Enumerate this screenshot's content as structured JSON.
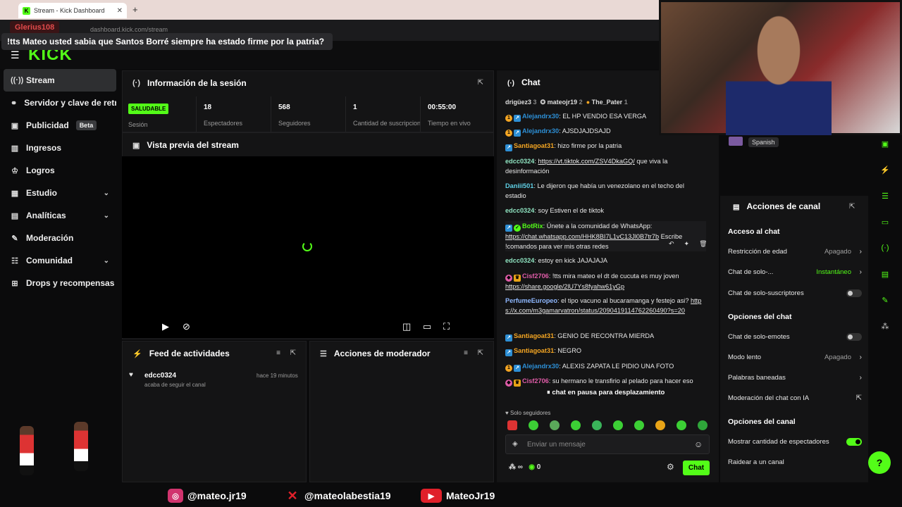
{
  "browser": {
    "tab_title": "Stream - Kick Dashboard",
    "tab_close": "✕",
    "new_tab": "+",
    "url": "dashboard.kick.com/stream"
  },
  "alert": {
    "user": "Glerius108",
    "message": "!tts Mateo usted sabia que Santos Borré siempre ha estado firme por la patria?"
  },
  "logo": "KICK",
  "sidebar": {
    "items": [
      {
        "label": "Stream",
        "icon": "broadcast-icon"
      },
      {
        "label": "Servidor y clave de retransmisión",
        "icon": "link-icon"
      },
      {
        "label": "Publicidad",
        "badge": "Beta",
        "icon": "ads-icon"
      },
      {
        "label": "Ingresos",
        "icon": "chart-icon"
      },
      {
        "label": "Logros",
        "icon": "trophy-icon"
      },
      {
        "label": "Estudio",
        "icon": "studio-icon"
      },
      {
        "label": "Analíticas",
        "icon": "analytics-icon"
      },
      {
        "label": "Moderación",
        "icon": "wrench-icon"
      },
      {
        "label": "Comunidad",
        "icon": "community-icon"
      },
      {
        "label": "Drops y recompensas",
        "icon": "gift-icon"
      }
    ]
  },
  "session": {
    "title": "Información de la sesión",
    "status": "SALUDABLE",
    "stats": [
      {
        "value": "",
        "label": "Sesión"
      },
      {
        "value": "18",
        "label": "Espectadores"
      },
      {
        "value": "568",
        "label": "Seguidores"
      },
      {
        "value": "1",
        "label": "Cantidad de suscripciones"
      },
      {
        "value": "00:55:00",
        "label": "Tiempo en vivo"
      }
    ]
  },
  "preview": {
    "title": "Vista previa del stream"
  },
  "feed": {
    "title": "Feed de actividades",
    "item_user": "edcc0324",
    "item_desc": "acaba de seguir el canal",
    "item_time": "hace 19 minutos"
  },
  "mod_actions": {
    "title": "Acciones de moderador"
  },
  "chat": {
    "title": "Chat",
    "top_users": [
      {
        "name": "drigüez3",
        "count": "3"
      },
      {
        "name": "mateojr19",
        "count": "2"
      },
      {
        "name": "The_Pater",
        "count": "1"
      }
    ],
    "messages": [
      {
        "user": "Alejandrx30",
        "color": "#2d8fd5",
        "text": "EL HP VENDIO ESA VERGA"
      },
      {
        "user": "Alejandrx30",
        "color": "#2d8fd5",
        "text": "AJSDJAJDSAJD"
      },
      {
        "user": "Santiagoat31",
        "color": "#f5a623",
        "text": "hizo firme por la patria"
      },
      {
        "user": "edcc0324",
        "color": "#8fe3c0",
        "link": "https://vt.tiktok.com/ZSV4DkaGQ/",
        "text": "que viva la desinformación"
      },
      {
        "user": "Daniii501",
        "color": "#5fd0e6",
        "text": "Le dijeron que había un venezolano en el techo del estadio"
      },
      {
        "user": "edcc0324",
        "color": "#8fe3c0",
        "text": "soy Estiven el de tiktok"
      },
      {
        "user": "BotRix",
        "color": "#53fc18",
        "text": "Únete a la comunidad de WhatsApp:",
        "link": "https://chat.whatsapp.com/HHK8BI7L1vC13Jl0B7tr7b",
        "text2": "Escribe !comandos para ver mis otras redes"
      },
      {
        "user": "edcc0324",
        "color": "#8fe3c0",
        "text": "estoy en kick JAJAJAJA"
      },
      {
        "user": "Cisf2706",
        "color": "#e05ca8",
        "text": "!tts mira mateo el dt de cucuta es muy joven",
        "link": "https://share.google/2lU7Ys8fyahw61yGp"
      },
      {
        "user": "PerfumeEuropeo",
        "color": "#8fb8ff",
        "text": "el tipo vacuno al bucaramanga y festejo asi?",
        "link": "https://x.com/m3gamarvatron/status/2090419114762260490?s=20"
      },
      {
        "user": "Santiagoat31",
        "color": "#f5a623",
        "text": "GENIO DE RECONTRA MIERDA"
      },
      {
        "user": "Santiagoat31",
        "color": "#f5a623",
        "text": "NEGRO"
      },
      {
        "user": "Alejandrx30",
        "color": "#2d8fd5",
        "text": "ALEXIS ZAPATA LE PIDIO UNA FOTO"
      },
      {
        "user": "Cisf2706",
        "color": "#e05ca8",
        "text": "su hermano le transfirio al pelado para hacer eso"
      }
    ],
    "pause_text": "chat en pausa para desplazamiento",
    "followers_only": "Solo seguidores",
    "input_placeholder": "Enviar un mensaje",
    "send_label": "Chat",
    "footer_count": "0"
  },
  "language": "Spanish",
  "channel_actions": {
    "title": "Acciones de canal",
    "sections": [
      {
        "title": "Acceso al chat"
      },
      {
        "title": "Opciones del chat"
      },
      {
        "title": "Opciones del canal"
      }
    ],
    "rows": {
      "age": {
        "label": "Restricción de edad",
        "value": "Apagado"
      },
      "solo": {
        "label": "Chat de solo-...",
        "value": "Instantáneo"
      },
      "subs": {
        "label": "Chat de solo-suscriptores"
      },
      "emotes": {
        "label": "Chat de solo-emotes"
      },
      "slow": {
        "label": "Modo lento",
        "value": "Apagado"
      },
      "banned": {
        "label": "Palabras baneadas"
      },
      "ai": {
        "label": "Moderación del chat con IA"
      },
      "viewers": {
        "label": "Mostrar cantidad de espectadores"
      },
      "raid": {
        "label": "Raidear a un canal"
      }
    }
  },
  "socials": {
    "instagram": "@mateo.jr19",
    "x": "@mateolabestia19",
    "youtube": "MateoJr19"
  },
  "colors": {
    "accent": "#53fc18",
    "panel": "#141415",
    "background": "#0b0b0c"
  }
}
